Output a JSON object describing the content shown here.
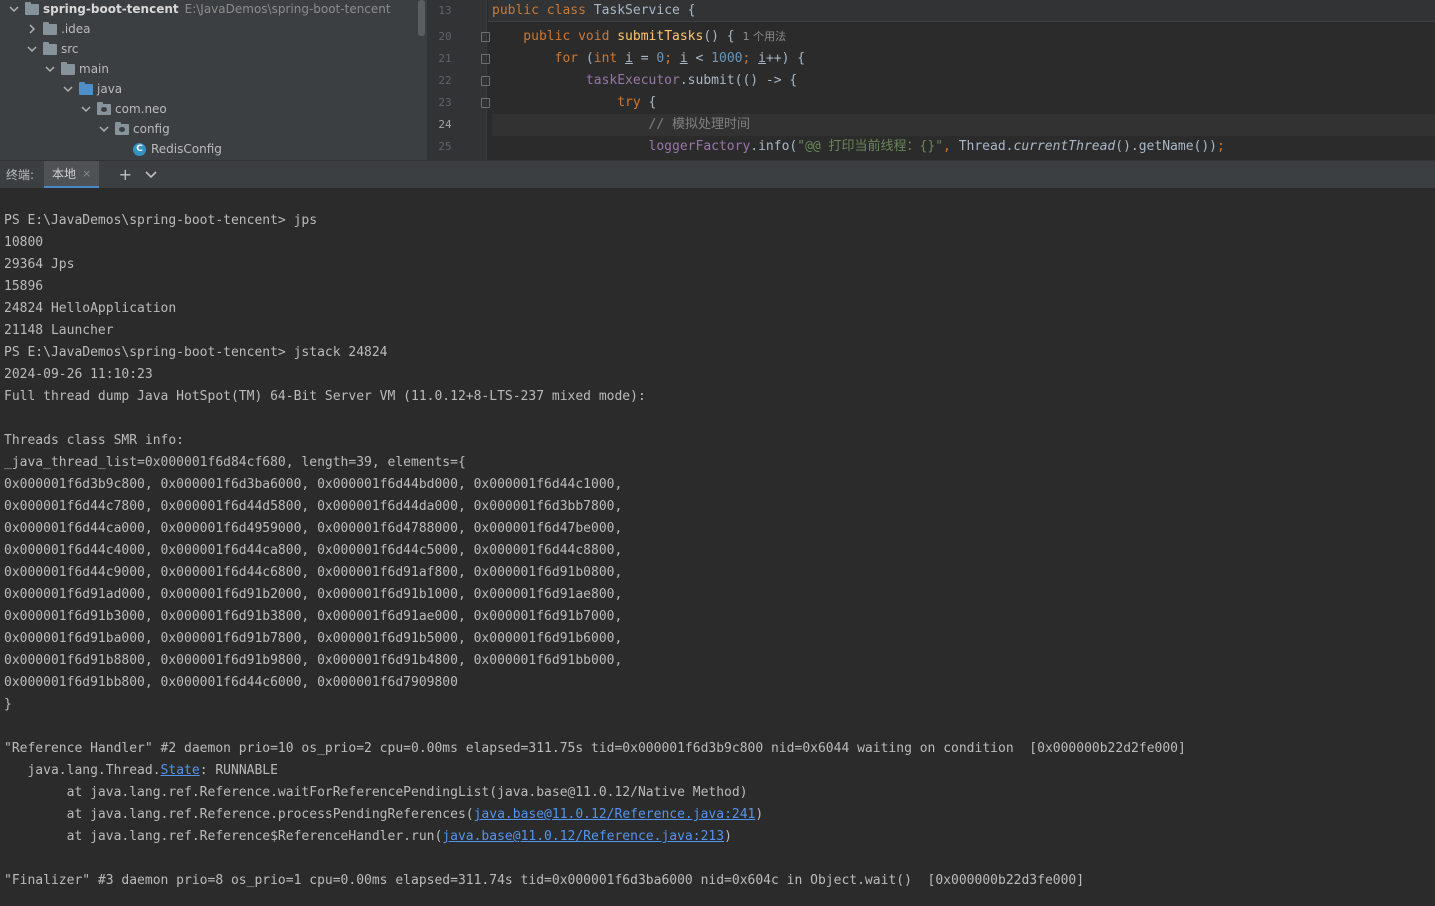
{
  "project_tree": {
    "items": [
      {
        "label": "spring-boot-tencent",
        "path": "E:\\JavaDemos\\spring-boot-tencent",
        "depth": 0,
        "expanded": true,
        "kind": "module"
      },
      {
        "label": ".idea",
        "depth": 1,
        "expanded": false,
        "kind": "folder"
      },
      {
        "label": "src",
        "depth": 1,
        "expanded": true,
        "kind": "folder"
      },
      {
        "label": "main",
        "depth": 2,
        "expanded": true,
        "kind": "folder"
      },
      {
        "label": "java",
        "depth": 3,
        "expanded": true,
        "kind": "source-folder"
      },
      {
        "label": "com.neo",
        "depth": 4,
        "expanded": true,
        "kind": "package"
      },
      {
        "label": "config",
        "depth": 5,
        "expanded": true,
        "kind": "package"
      },
      {
        "label": "RedisConfig",
        "depth": 6,
        "kind": "class"
      }
    ]
  },
  "editor": {
    "lines": [
      {
        "num": "13",
        "segments": [
          [
            "kw",
            "public class "
          ],
          [
            "",
            "TaskService {"
          ]
        ],
        "sticky": true
      },
      {
        "num": "20",
        "segments": [
          [
            "kw",
            "    public void "
          ],
          [
            "fn",
            "submitTasks"
          ],
          [
            "",
            "() {"
          ]
        ],
        "hint": "1 个用法",
        "fold": true
      },
      {
        "num": "21",
        "segments": [
          [
            "kw",
            "        for "
          ],
          [
            "",
            "("
          ],
          [
            "kw",
            "int "
          ],
          [
            "ul",
            "i"
          ],
          [
            "",
            " = "
          ],
          [
            "num",
            "0"
          ],
          [
            "kw",
            "; "
          ],
          [
            "ul",
            "i"
          ],
          [
            "",
            " < "
          ],
          [
            "num",
            "1000"
          ],
          [
            "kw",
            "; "
          ],
          [
            "ul",
            "i"
          ],
          [
            "",
            "++) {"
          ]
        ],
        "fold": true
      },
      {
        "num": "22",
        "segments": [
          [
            "field",
            "            taskExecutor"
          ],
          [
            "",
            ".submit(() -> {"
          ]
        ],
        "fold": true
      },
      {
        "num": "23",
        "segments": [
          [
            "kw",
            "                try "
          ],
          [
            "",
            "{"
          ]
        ],
        "fold": true
      },
      {
        "num": "24",
        "segments": [
          [
            "cmt",
            "                    // 模拟处理时间"
          ]
        ],
        "current": true
      },
      {
        "num": "25",
        "segments": [
          [
            "field",
            "                    loggerFactory"
          ],
          [
            "",
            ".info("
          ],
          [
            "str",
            "\"@@ 打印当前线程：{}\""
          ],
          [
            "kw",
            ", "
          ],
          [
            "",
            "Thread."
          ],
          [
            "italic",
            "currentThread"
          ],
          [
            "",
            "().getName())"
          ],
          [
            "kw",
            ";"
          ]
        ]
      }
    ]
  },
  "terminal_bar": {
    "label": "终端:",
    "tab_label": "本地",
    "close_glyph": "×",
    "add_glyph": "+"
  },
  "terminal": {
    "lines": [
      "",
      "PS E:\\JavaDemos\\spring-boot-tencent> jps",
      "10800",
      "29364 Jps",
      "15896",
      "24824 HelloApplication",
      "21148 Launcher",
      "PS E:\\JavaDemos\\spring-boot-tencent> jstack 24824",
      "2024-09-26 11:10:23",
      "Full thread dump Java HotSpot(TM) 64-Bit Server VM (11.0.12+8-LTS-237 mixed mode):",
      "",
      "Threads class SMR info:",
      "_java_thread_list=0x000001f6d84cf680, length=39, elements={",
      "0x000001f6d3b9c800, 0x000001f6d3ba6000, 0x000001f6d44bd000, 0x000001f6d44c1000,",
      "0x000001f6d44c7800, 0x000001f6d44d5800, 0x000001f6d44da000, 0x000001f6d3bb7800,",
      "0x000001f6d44ca000, 0x000001f6d4959000, 0x000001f6d4788000, 0x000001f6d47be000,",
      "0x000001f6d44c4000, 0x000001f6d44ca800, 0x000001f6d44c5000, 0x000001f6d44c8800,",
      "0x000001f6d44c9000, 0x000001f6d44c6800, 0x000001f6d91af800, 0x000001f6d91b0800,",
      "0x000001f6d91ad000, 0x000001f6d91b2000, 0x000001f6d91b1000, 0x000001f6d91ae800,",
      "0x000001f6d91b3000, 0x000001f6d91b3800, 0x000001f6d91ae000, 0x000001f6d91b7000,",
      "0x000001f6d91ba000, 0x000001f6d91b7800, 0x000001f6d91b5000, 0x000001f6d91b6000,",
      "0x000001f6d91b8800, 0x000001f6d91b9800, 0x000001f6d91b4800, 0x000001f6d91bb000,",
      "0x000001f6d91bb800, 0x000001f6d44c6000, 0x000001f6d7909800",
      "}",
      "",
      "\"Reference Handler\" #2 daemon prio=10 os_prio=2 cpu=0.00ms elapsed=311.75s tid=0x000001f6d3b9c800 nid=0x6044 waiting on condition  [0x000000b22d2fe000]",
      {
        "parts": [
          [
            "",
            "   java.lang.Thread."
          ],
          [
            "link",
            "State"
          ],
          [
            "",
            ": RUNNABLE"
          ]
        ]
      },
      "        at java.lang.ref.Reference.waitForReferencePendingList(java.base@11.0.12/Native Method)",
      {
        "parts": [
          [
            "",
            "        at java.lang.ref.Reference.processPendingReferences("
          ],
          [
            "link",
            "java.base@11.0.12/Reference.java:241"
          ],
          [
            "",
            ")"
          ]
        ]
      },
      {
        "parts": [
          [
            "",
            "        at java.lang.ref.Reference$ReferenceHandler.run("
          ],
          [
            "link",
            "java.base@11.0.12/Reference.java:213"
          ],
          [
            "",
            ")"
          ]
        ]
      },
      "",
      "\"Finalizer\" #3 daemon prio=8 os_prio=1 cpu=0.00ms elapsed=311.74s tid=0x000001f6d3ba6000 nid=0x604c in Object.wait()  [0x000000b22d3fe000]"
    ]
  }
}
